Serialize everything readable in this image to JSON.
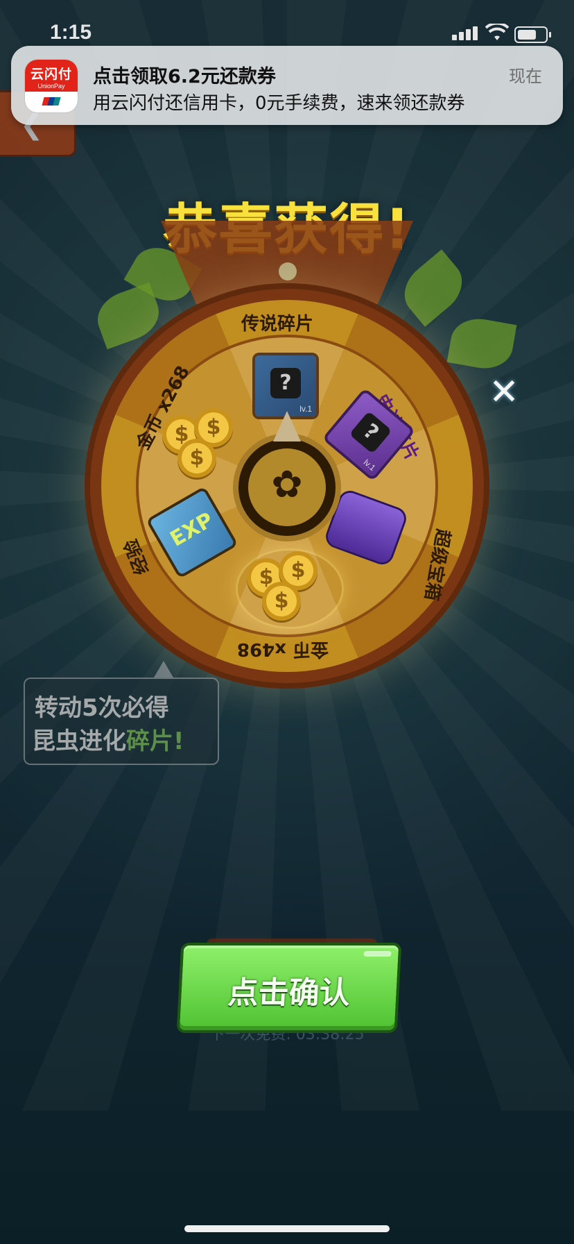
{
  "status_bar": {
    "time": "1:15"
  },
  "notification": {
    "app_name_cn": "云闪付",
    "app_name_en": "UnionPay",
    "title": "点击领取6.2元还款券",
    "body": "用云闪付还信用卡，0元手续费，速来领还款券",
    "time": "现在"
  },
  "headline": "恭喜获得!",
  "wheel": {
    "segments": {
      "legend_shard": "传说碎片",
      "epic_shard": "史诗碎片",
      "super_chest": "超级宝箱",
      "coins_498": "金币 x498",
      "exp": "经验",
      "coins_268": "金币 x268"
    },
    "card_level": "lv.1",
    "exp_label": "EXP",
    "hub_icon": "beetle-icon"
  },
  "hint": {
    "line1": "转动5次必得",
    "line2_prefix": "昆虫进化",
    "line2_highlight": "碎片!"
  },
  "confirm_button": "点击确认",
  "next_free_text": "下一次免费: 03:38:25",
  "colors": {
    "headline": "#f8e13c",
    "confirm_button": "#5fd23c"
  }
}
